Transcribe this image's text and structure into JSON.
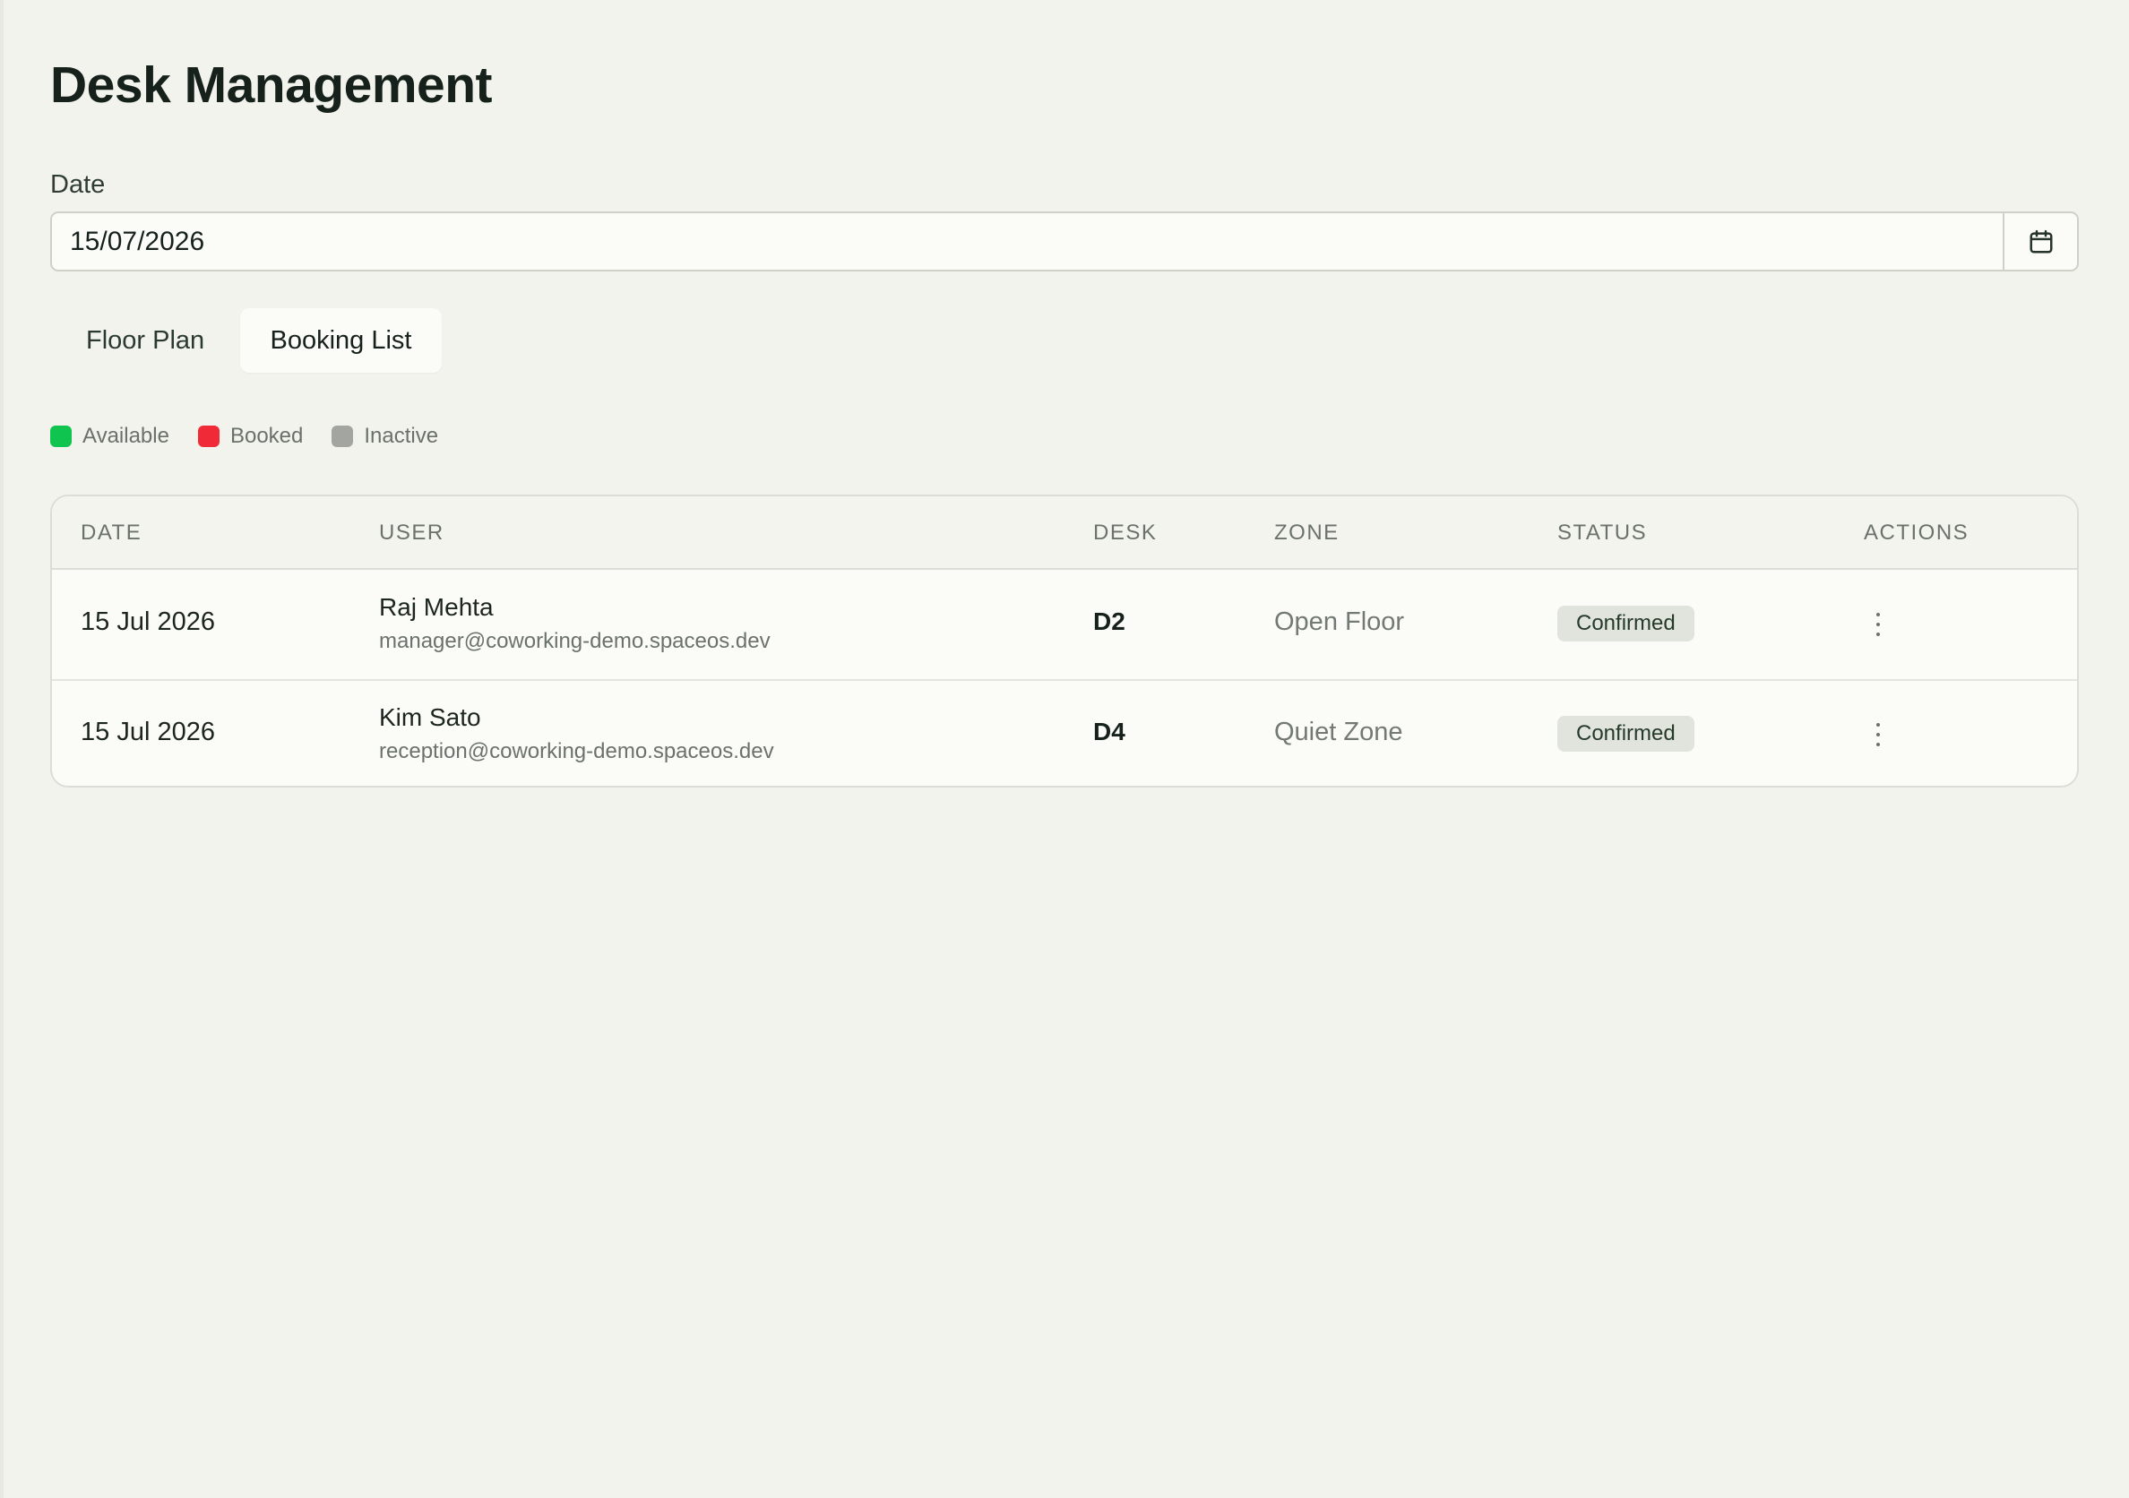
{
  "page": {
    "title": "Desk Management"
  },
  "date_filter": {
    "label": "Date",
    "value": "15/07/2026",
    "calendar_icon": "calendar-icon"
  },
  "tabs": [
    {
      "label": "Floor Plan",
      "active": false
    },
    {
      "label": "Booking List",
      "active": true
    }
  ],
  "legend": [
    {
      "label": "Available",
      "color": "#0fc44f"
    },
    {
      "label": "Booked",
      "color": "#f02a36"
    },
    {
      "label": "Inactive",
      "color": "#a3a6a0"
    }
  ],
  "table": {
    "headers": {
      "date": "DATE",
      "user": "USER",
      "desk": "DESK",
      "zone": "ZONE",
      "status": "STATUS",
      "actions": "ACTIONS"
    },
    "rows": [
      {
        "date": "15 Jul 2026",
        "user_name": "Raj Mehta",
        "user_email": "manager@coworking-demo.spaceos.dev",
        "desk": "D2",
        "zone": "Open Floor",
        "status": "Confirmed",
        "action_icon": "more-vertical-icon"
      },
      {
        "date": "15 Jul 2026",
        "user_name": "Kim Sato",
        "user_email": "reception@coworking-demo.spaceos.dev",
        "desk": "D4",
        "zone": "Quiet Zone",
        "status": "Confirmed",
        "action_icon": "more-vertical-icon"
      }
    ]
  }
}
